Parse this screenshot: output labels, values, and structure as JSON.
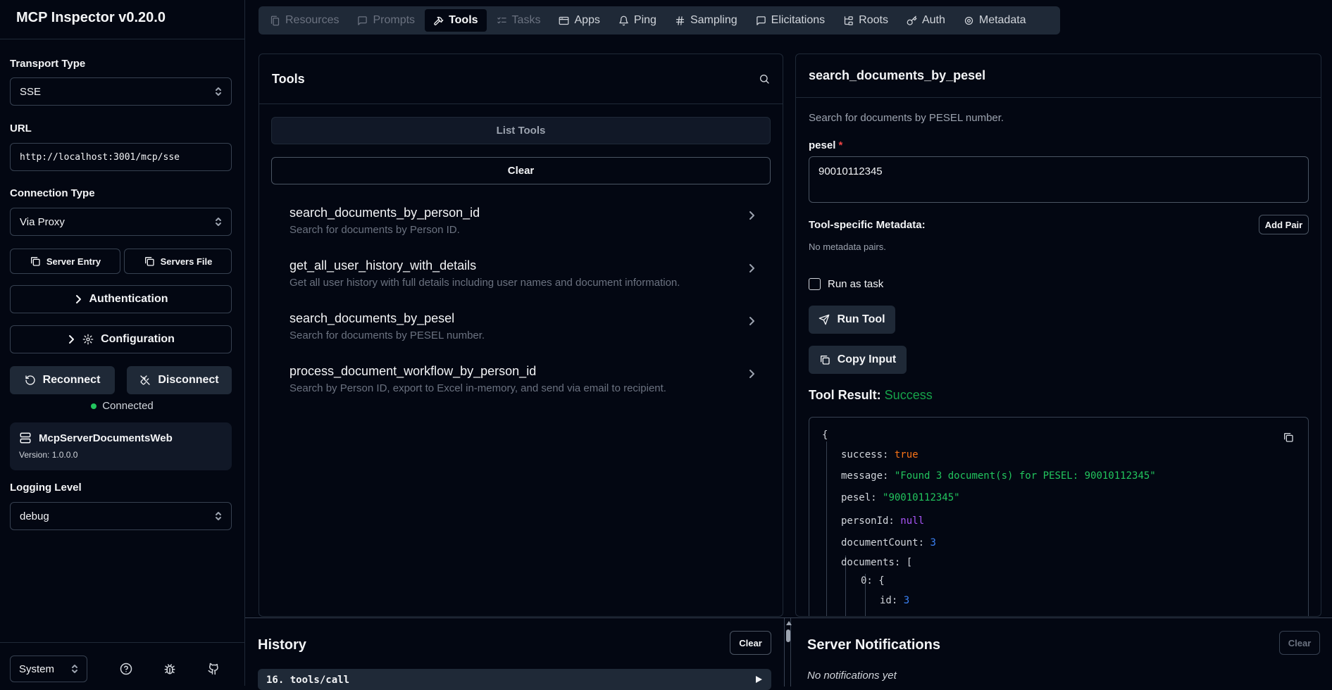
{
  "app": {
    "title": "MCP Inspector v0.20.0"
  },
  "sidebar": {
    "transport_label": "Transport Type",
    "transport_value": "SSE",
    "url_label": "URL",
    "url_value": "http://localhost:3001/mcp/sse",
    "connection_label": "Connection Type",
    "connection_value": "Via Proxy",
    "server_entry": "Server Entry",
    "servers_file": "Servers File",
    "authentication": "Authentication",
    "configuration": "Configuration",
    "reconnect": "Reconnect",
    "disconnect": "Disconnect",
    "status": "Connected",
    "server_name": "McpServerDocumentsWeb",
    "server_version": "Version: 1.0.0.0",
    "logging_label": "Logging Level",
    "logging_value": "debug",
    "theme_value": "System"
  },
  "tabs": [
    {
      "label": "Resources",
      "icon": "files-icon",
      "state": "disabled"
    },
    {
      "label": "Prompts",
      "icon": "message-icon",
      "state": "disabled"
    },
    {
      "label": "Tools",
      "icon": "hammer-icon",
      "state": "active"
    },
    {
      "label": "Tasks",
      "icon": "list-checks-icon",
      "state": "disabled"
    },
    {
      "label": "Apps",
      "icon": "app-window-icon",
      "state": "normal"
    },
    {
      "label": "Ping",
      "icon": "bell-icon",
      "state": "normal"
    },
    {
      "label": "Sampling",
      "icon": "hash-icon",
      "state": "normal"
    },
    {
      "label": "Elicitations",
      "icon": "message-square-icon",
      "state": "normal"
    },
    {
      "label": "Roots",
      "icon": "folder-tree-icon",
      "state": "normal"
    },
    {
      "label": "Auth",
      "icon": "key-icon",
      "state": "normal"
    },
    {
      "label": "Metadata",
      "icon": "gear-icon",
      "state": "normal"
    }
  ],
  "tools": {
    "title": "Tools",
    "list_button": "List Tools",
    "clear_button": "Clear",
    "items": [
      {
        "name": "search_documents_by_person_id",
        "description": "Search for documents by Person ID."
      },
      {
        "name": "get_all_user_history_with_details",
        "description": "Get all user history with full details including user names and document information."
      },
      {
        "name": "search_documents_by_pesel",
        "description": "Search for documents by PESEL number."
      },
      {
        "name": "process_document_workflow_by_person_id",
        "description": "Search by Person ID, export to Excel in-memory, and send via email to recipient."
      }
    ]
  },
  "detail": {
    "title": "search_documents_by_pesel",
    "description": "Search for documents by PESEL number.",
    "param_name": "pesel",
    "param_required_mark": "*",
    "param_value": "90010112345",
    "metadata_label": "Tool-specific Metadata:",
    "add_pair": "Add Pair",
    "no_metadata": "No metadata pairs.",
    "run_as_task": "Run as task",
    "run_tool": "Run Tool",
    "copy_input": "Copy Input",
    "result_label": "Tool Result:",
    "result_status": "Success",
    "result": {
      "open_brace": "{",
      "success_key": "success:",
      "success_val": "true",
      "message_key": "message:",
      "message_val": "\"Found 3 document(s) for PESEL: 90010112345\"",
      "pesel_key": "pesel:",
      "pesel_val": "\"90010112345\"",
      "personid_key": "personId:",
      "personid_val": "null",
      "count_key": "documentCount:",
      "count_val": "3",
      "documents_key": "documents:",
      "documents_open": "[",
      "item0_key": "0:",
      "item0_open": "{",
      "id_key": "id:",
      "id_val": "3"
    }
  },
  "history": {
    "title": "History",
    "clear": "Clear",
    "item": "16. tools/call"
  },
  "notifications": {
    "title": "Server Notifications",
    "clear": "Clear",
    "empty": "No notifications yet"
  },
  "colors": {
    "background": "#030712",
    "panel_border": "#1f2937",
    "success": "#16a34a",
    "connected_dot": "#22c55e",
    "required": "#ef4444"
  }
}
